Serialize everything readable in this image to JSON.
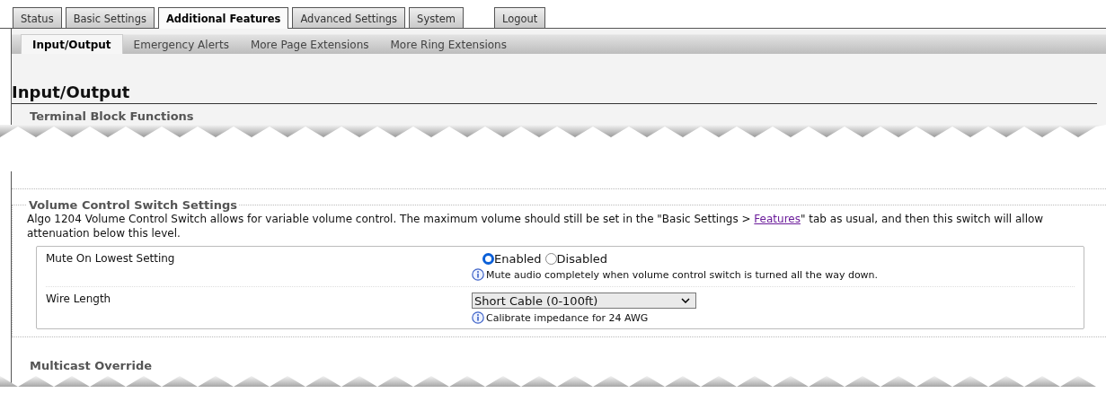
{
  "tabs": [
    {
      "label": "Status",
      "selected": false
    },
    {
      "label": "Basic Settings",
      "selected": false
    },
    {
      "label": "Additional Features",
      "selected": true
    },
    {
      "label": "Advanced Settings",
      "selected": false
    },
    {
      "label": "System",
      "selected": false
    },
    {
      "label": "Logout",
      "selected": false
    }
  ],
  "subtabs": [
    {
      "label": "Input/Output",
      "selected": true
    },
    {
      "label": "Emergency Alerts",
      "selected": false
    },
    {
      "label": "More Page Extensions",
      "selected": false
    },
    {
      "label": "More Ring Extensions",
      "selected": false
    }
  ],
  "page_title": "Input/Output",
  "terminal_section": {
    "title": "Terminal Block Functions"
  },
  "volume_section": {
    "title": "Volume Control Switch Settings",
    "description_before": "Algo 1204 Volume Control Switch allows for variable volume control. The maximum volume should still be set in the \"Basic Settings > ",
    "description_link": "Features",
    "description_after": "\" tab as usual, and then this switch will allow attenuation below this level.",
    "settings": [
      {
        "kind": "radio",
        "label": "Mute On Lowest Setting",
        "options": [
          {
            "label": "Enabled",
            "selected": true
          },
          {
            "label": "Disabled",
            "selected": false
          }
        ],
        "hint": "Mute audio completely when volume control switch is turned all the way down."
      },
      {
        "kind": "select",
        "label": "Wire Length",
        "value": "Short Cable (0-100ft)",
        "hint": "Calibrate impedance for 24 AWG"
      }
    ]
  },
  "multicast_section": {
    "title": "Multicast Override"
  }
}
